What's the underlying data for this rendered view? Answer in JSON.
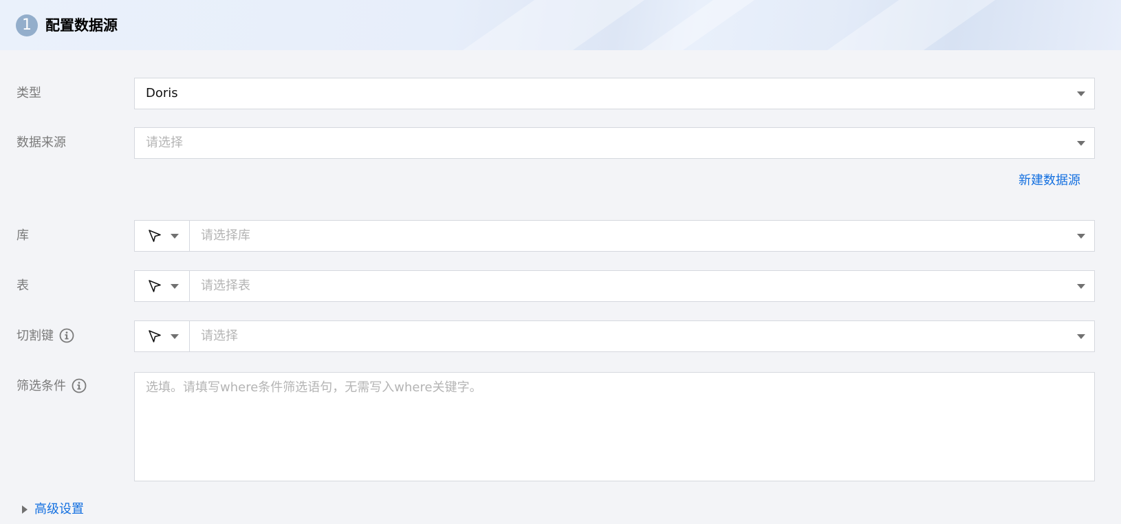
{
  "section": {
    "step_number": "1",
    "title": "配置数据源"
  },
  "form": {
    "type": {
      "label": "类型",
      "value": "Doris"
    },
    "datasource": {
      "label": "数据来源",
      "placeholder": "请选择"
    },
    "new_datasource_link": "新建数据源",
    "database": {
      "label": "库",
      "placeholder": "请选择库",
      "mode_icon": "pointer-icon"
    },
    "table": {
      "label": "表",
      "placeholder": "请选择表",
      "mode_icon": "pointer-icon"
    },
    "split_key": {
      "label": "切割键",
      "placeholder": "请选择",
      "mode_icon": "pointer-icon",
      "help_icon": "info-icon"
    },
    "filter": {
      "label": "筛选条件",
      "placeholder": "选填。请填写where条件筛选语句，无需写入where关键字。",
      "help_icon": "info-icon"
    },
    "advanced_settings": "高级设置"
  },
  "colors": {
    "link": "#1470e0",
    "label": "#7a7a7a",
    "placeholder": "#b4b4b4",
    "step_circle": "#93aecb",
    "border": "#d5d8de",
    "page_bg": "#f3f4f7"
  }
}
